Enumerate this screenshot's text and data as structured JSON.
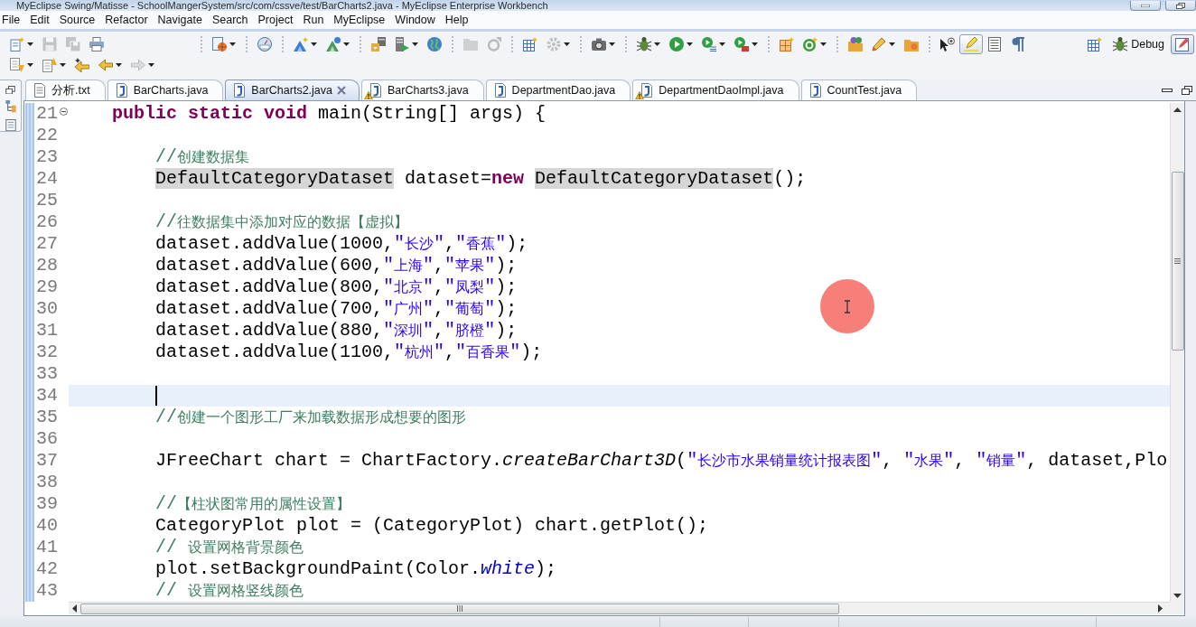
{
  "window": {
    "title": "MyEclipse Swing/Matisse - SchoolMangerSystem/src/com/cssve/test/BarCharts2.java - MyEclipse Enterprise Workbench"
  },
  "menu": [
    "File",
    "Edit",
    "Source",
    "Refactor",
    "Navigate",
    "Search",
    "Project",
    "Run",
    "MyEclipse",
    "Window",
    "Help"
  ],
  "toolbar": {
    "rows": [
      [
        [
          {
            "kind": "new",
            "dropdown": true,
            "disabled": false,
            "on": false
          },
          {
            "kind": "save",
            "dropdown": false,
            "disabled": true,
            "on": false
          },
          {
            "kind": "save-all",
            "dropdown": false,
            "disabled": true,
            "on": false
          },
          {
            "kind": "print",
            "dropdown": false,
            "disabled": false,
            "on": false
          }
        ],
        [
          {
            "kind": "web-project",
            "dropdown": true,
            "disabled": false,
            "on": false
          }
        ],
        [
          {
            "kind": "gauge",
            "dropdown": false,
            "disabled": false,
            "on": false
          }
        ],
        [
          {
            "kind": "wizard",
            "dropdown": true,
            "disabled": false,
            "on": false
          },
          {
            "kind": "wizard2",
            "dropdown": true,
            "disabled": false,
            "on": false
          }
        ],
        [
          {
            "kind": "deploy",
            "dropdown": false,
            "disabled": false,
            "on": false
          },
          {
            "kind": "server",
            "dropdown": true,
            "disabled": false,
            "on": false
          },
          {
            "kind": "globe",
            "dropdown": false,
            "disabled": false,
            "on": false
          }
        ],
        [
          {
            "kind": "folder",
            "dropdown": false,
            "disabled": true,
            "on": false
          },
          {
            "kind": "refresh",
            "dropdown": false,
            "disabled": true,
            "on": false
          }
        ],
        [
          {
            "kind": "report",
            "dropdown": false,
            "disabled": false,
            "on": false
          },
          {
            "kind": "gear",
            "dropdown": true,
            "disabled": true,
            "on": false
          }
        ],
        [
          {
            "kind": "camera",
            "dropdown": true,
            "disabled": false,
            "on": false
          }
        ],
        [
          {
            "kind": "debug",
            "dropdown": true,
            "disabled": false,
            "on": false
          },
          {
            "kind": "run",
            "dropdown": true,
            "disabled": false,
            "on": false
          },
          {
            "kind": "run-list",
            "dropdown": true,
            "disabled": false,
            "on": false
          },
          {
            "kind": "run-tool",
            "dropdown": true,
            "disabled": false,
            "on": false
          }
        ],
        [
          {
            "kind": "grid-star",
            "dropdown": false,
            "disabled": false,
            "on": false
          },
          {
            "kind": "class",
            "dropdown": true,
            "disabled": false,
            "on": false
          }
        ],
        [
          {
            "kind": "folder-balls",
            "dropdown": false,
            "disabled": false,
            "on": false
          },
          {
            "kind": "pencil",
            "dropdown": true,
            "disabled": false,
            "on": false
          },
          {
            "kind": "folder-open",
            "dropdown": false,
            "disabled": false,
            "on": false
          }
        ],
        [
          {
            "kind": "pointer",
            "dropdown": false,
            "disabled": false,
            "on": false
          },
          {
            "kind": "highlighter",
            "dropdown": false,
            "disabled": false,
            "on": true
          },
          {
            "kind": "block",
            "dropdown": false,
            "disabled": false,
            "on": false
          },
          {
            "kind": "pilcrow",
            "dropdown": false,
            "disabled": false,
            "on": false
          }
        ]
      ],
      [
        [
          {
            "kind": "next-annotation",
            "dropdown": true,
            "disabled": false,
            "on": false
          },
          {
            "kind": "prev-annotation",
            "dropdown": true,
            "disabled": false,
            "on": false
          },
          {
            "kind": "last-edit",
            "dropdown": false,
            "disabled": false,
            "on": false
          },
          {
            "kind": "back",
            "dropdown": true,
            "disabled": false,
            "on": false
          },
          {
            "kind": "forward",
            "dropdown": true,
            "disabled": true,
            "on": false
          }
        ]
      ]
    ],
    "perspectives": [
      {
        "kind": "debug",
        "label": "Debug",
        "selected": false
      },
      {
        "kind": "myeclipse",
        "selected": true
      }
    ]
  },
  "tabs": [
    {
      "label": "分析.txt",
      "kind": "text",
      "warning": false,
      "selected": false
    },
    {
      "label": "BarCharts.java",
      "kind": "java",
      "warning": false,
      "selected": false
    },
    {
      "label": "BarCharts2.java",
      "kind": "java",
      "warning": false,
      "selected": true
    },
    {
      "label": "BarCharts3.java",
      "kind": "java",
      "warning": true,
      "selected": false
    },
    {
      "label": "DepartmentDao.java",
      "kind": "java",
      "warning": false,
      "selected": false
    },
    {
      "label": "DepartmentDaoImpl.java",
      "kind": "java",
      "warning": true,
      "selected": false
    },
    {
      "label": "CountTest.java",
      "kind": "java",
      "warning": false,
      "selected": false
    }
  ],
  "editor": {
    "lines": [
      {
        "number": "21",
        "current": false,
        "expanded": true,
        "tokens": [
          {
            "kind": "keyword",
            "text": "    public static void"
          },
          {
            "kind": "plain",
            "text": " main(String[] args) {"
          }
        ]
      },
      {
        "number": "22",
        "current": false
      },
      {
        "number": "23",
        "current": false,
        "tokens": [
          {
            "kind": "comment",
            "text": "        //创建数据集"
          }
        ]
      },
      {
        "number": "24",
        "current": false,
        "tokens": [
          {
            "kind": "occurrence",
            "text": "        DefaultCategoryDataset"
          },
          {
            "kind": "plain",
            "text": " dataset="
          },
          {
            "kind": "keyword",
            "text": "new "
          },
          {
            "kind": "occurrence",
            "text": "DefaultCategoryDataset"
          },
          {
            "kind": "plain",
            "text": "();"
          }
        ]
      },
      {
        "number": "25",
        "current": false
      },
      {
        "number": "26",
        "current": false,
        "tokens": [
          {
            "kind": "comment",
            "text": "        //往数据集中添加对应的数据【虚拟】"
          }
        ]
      },
      {
        "number": "27",
        "current": false,
        "tokens": [
          {
            "kind": "plain",
            "text": "        dataset.addValue(1000,"
          },
          {
            "kind": "string",
            "text": "\"长沙\""
          },
          {
            "kind": "plain",
            "text": ","
          },
          {
            "kind": "string",
            "text": "\"香蕉\""
          },
          {
            "kind": "plain",
            "text": ");"
          }
        ]
      },
      {
        "number": "28",
        "current": false,
        "tokens": [
          {
            "kind": "plain",
            "text": "        dataset.addValue(600,"
          },
          {
            "kind": "string",
            "text": "\"上海\""
          },
          {
            "kind": "plain",
            "text": ","
          },
          {
            "kind": "string",
            "text": "\"苹果\""
          },
          {
            "kind": "plain",
            "text": ");"
          }
        ]
      },
      {
        "number": "29",
        "current": false,
        "tokens": [
          {
            "kind": "plain",
            "text": "        dataset.addValue(800,"
          },
          {
            "kind": "string",
            "text": "\"北京\""
          },
          {
            "kind": "plain",
            "text": ","
          },
          {
            "kind": "string",
            "text": "\"凤梨\""
          },
          {
            "kind": "plain",
            "text": ");"
          }
        ]
      },
      {
        "number": "30",
        "current": false,
        "tokens": [
          {
            "kind": "plain",
            "text": "        dataset.addValue(700,"
          },
          {
            "kind": "string",
            "text": "\"广州\""
          },
          {
            "kind": "plain",
            "text": ","
          },
          {
            "kind": "string",
            "text": "\"葡萄\""
          },
          {
            "kind": "plain",
            "text": ");"
          }
        ]
      },
      {
        "number": "31",
        "current": false,
        "tokens": [
          {
            "kind": "plain",
            "text": "        dataset.addValue(880,"
          },
          {
            "kind": "string",
            "text": "\"深圳\""
          },
          {
            "kind": "plain",
            "text": ","
          },
          {
            "kind": "string",
            "text": "\"脐橙\""
          },
          {
            "kind": "plain",
            "text": ");"
          }
        ]
      },
      {
        "number": "32",
        "current": false,
        "tokens": [
          {
            "kind": "plain",
            "text": "        dataset.addValue(1100,"
          },
          {
            "kind": "string",
            "text": "\"杭州\""
          },
          {
            "kind": "plain",
            "text": ","
          },
          {
            "kind": "string",
            "text": "\"百香果\""
          },
          {
            "kind": "plain",
            "text": ");"
          }
        ]
      },
      {
        "number": "33",
        "current": false
      },
      {
        "number": "34",
        "current": true
      },
      {
        "number": "35",
        "current": false,
        "tokens": [
          {
            "kind": "comment",
            "text": "        //创建一个图形工厂来加载数据形成想要的图形"
          }
        ]
      },
      {
        "number": "36",
        "current": false
      },
      {
        "number": "37",
        "current": false,
        "tokens": [
          {
            "kind": "plain",
            "text": "        JFreeChart chart = ChartFactory."
          },
          {
            "kind": "italic",
            "text": "createBarChart3D"
          },
          {
            "kind": "plain",
            "text": "("
          },
          {
            "kind": "string",
            "text": "\"长沙市水果销量统计报表图\""
          },
          {
            "kind": "plain",
            "text": ", "
          },
          {
            "kind": "string",
            "text": "\"水果\""
          },
          {
            "kind": "plain",
            "text": ", "
          },
          {
            "kind": "string",
            "text": "\"销量\""
          },
          {
            "kind": "plain",
            "text": ", dataset,Plo"
          }
        ]
      },
      {
        "number": "38",
        "current": false
      },
      {
        "number": "39",
        "current": false,
        "tokens": [
          {
            "kind": "comment",
            "text": "        //【柱状图常用的属性设置】"
          }
        ]
      },
      {
        "number": "40",
        "current": false,
        "tokens": [
          {
            "kind": "plain",
            "text": "        CategoryPlot plot = (CategoryPlot) chart.getPlot();"
          }
        ]
      },
      {
        "number": "41",
        "current": false,
        "tokens": [
          {
            "kind": "comment",
            "text": "        // 设置网格背景颜色"
          }
        ]
      },
      {
        "number": "42",
        "current": false,
        "tokens": [
          {
            "kind": "plain",
            "text": "        plot.setBackgroundPaint(Color."
          },
          {
            "kind": "field",
            "text": "white"
          },
          {
            "kind": "plain",
            "text": ");"
          }
        ]
      },
      {
        "number": "43",
        "current": false,
        "tokens": [
          {
            "kind": "comment",
            "text": "        // 设置网格竖线颜色"
          }
        ]
      }
    ]
  }
}
